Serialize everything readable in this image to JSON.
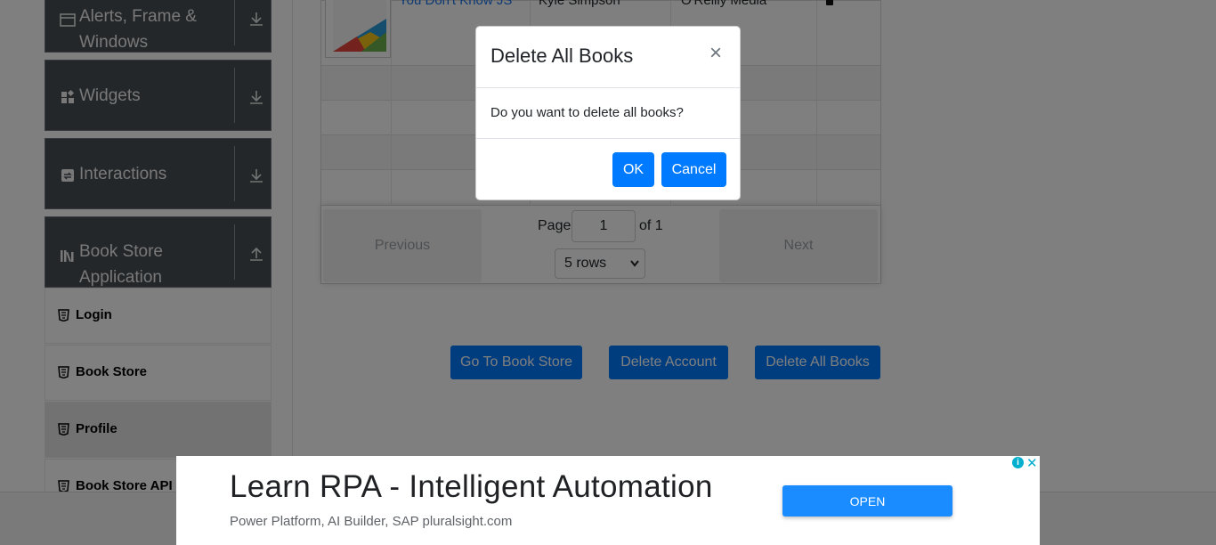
{
  "sidebar": {
    "groups": [
      {
        "label_line1": "Alerts, Frame &",
        "label_line2": "Windows",
        "icon": "window-icon",
        "arrow": "download-arrow-icon"
      },
      {
        "label": "Widgets",
        "icon": "widgets-icon",
        "arrow": "download-arrow-icon"
      },
      {
        "label": "Interactions",
        "icon": "interactions-icon",
        "arrow": "download-arrow-icon"
      },
      {
        "label_line1": "Book Store",
        "label_line2": "Application",
        "icon": "books-icon",
        "arrow": "upload-arrow-icon"
      }
    ],
    "items": [
      {
        "label": "Login",
        "icon": "html5-icon"
      },
      {
        "label": "Book Store",
        "icon": "html5-icon"
      },
      {
        "label": "Profile",
        "icon": "html5-icon"
      },
      {
        "label": "Book Store API",
        "icon": "html5-icon"
      }
    ]
  },
  "table": {
    "first_row": {
      "title": "You Don't Know JS",
      "author": "Kyle Simpson",
      "publisher": "O'Reilly Media"
    }
  },
  "pagination": {
    "previous": "Previous",
    "next": "Next",
    "page_label": "Page",
    "page_value": "1",
    "of_label": "of 1",
    "rows_selected": "5 rows"
  },
  "actions": {
    "go_to_store": "Go To Book Store",
    "delete_account": "Delete Account",
    "delete_all_books": "Delete All Books"
  },
  "modal": {
    "title": "Delete All Books",
    "close": "×",
    "body": "Do you want to delete all books?",
    "ok": "OK",
    "cancel": "Cancel"
  },
  "ad": {
    "headline": "Learn RPA - Intelligent Automation",
    "subline": "Power Platform, AI Builder, SAP pluralsight.com",
    "open": "OPEN",
    "info": "i",
    "close": "✕"
  },
  "colors": {
    "primary": "#007bff",
    "sidebar_group": "#484e55",
    "overlay": "rgba(0,0,0,0.5)"
  }
}
